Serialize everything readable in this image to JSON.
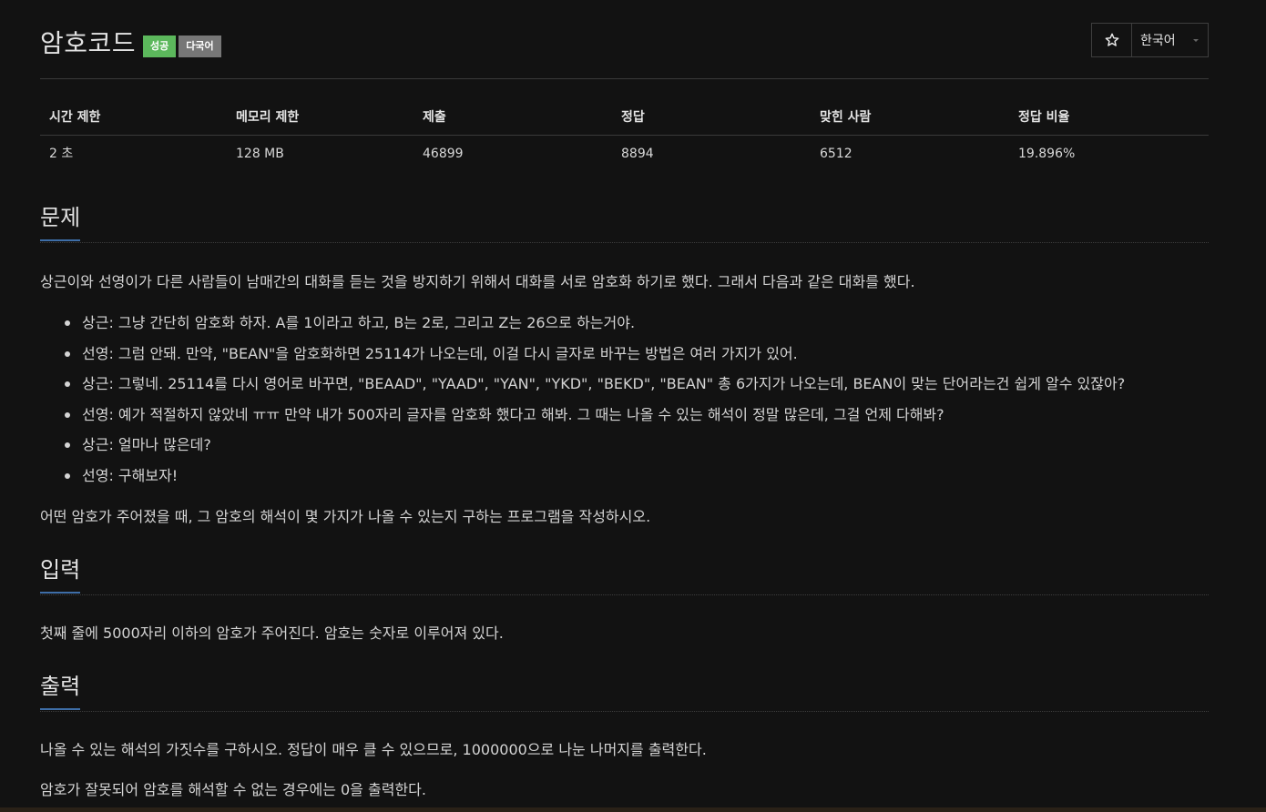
{
  "header": {
    "title": "암호코드",
    "badges": {
      "success": "성공",
      "multilang": "다국어"
    },
    "star_icon": "star-outline-icon",
    "language": "한국어"
  },
  "stats": {
    "headers": [
      "시간 제한",
      "메모리 제한",
      "제출",
      "정답",
      "맞힌 사람",
      "정답 비율"
    ],
    "values": [
      "2 초",
      "128 MB",
      "46899",
      "8894",
      "6512",
      "19.896%"
    ]
  },
  "problem": {
    "title": "문제",
    "intro": "상근이와 선영이가 다른 사람들이 남매간의 대화를 듣는 것을 방지하기 위해서 대화를 서로 암호화 하기로 했다. 그래서 다음과 같은 대화를 했다.",
    "dialog": [
      "상근: 그냥 간단히 암호화 하자. A를 1이라고 하고, B는 2로, 그리고 Z는 26으로 하는거야.",
      "선영: 그럼 안돼. 만약, \"BEAN\"을 암호화하면 25114가 나오는데, 이걸 다시 글자로 바꾸는 방법은 여러 가지가 있어.",
      "상근: 그렇네. 25114를 다시 영어로 바꾸면, \"BEAAD\", \"YAAD\", \"YAN\", \"YKD\", \"BEKD\", \"BEAN\" 총 6가지가 나오는데, BEAN이 맞는 단어라는건 쉽게 알수 있잖아?",
      "선영: 예가 적절하지 않았네 ㅠㅠ 만약 내가 500자리 글자를 암호화 했다고 해봐. 그 때는 나올 수 있는 해석이 정말 많은데, 그걸 언제 다해봐?",
      "상근: 얼마나 많은데?",
      "선영: 구해보자!"
    ],
    "outro": "어떤 암호가 주어졌을 때, 그 암호의 해석이 몇 가지가 나올 수 있는지 구하는 프로그램을 작성하시오."
  },
  "input": {
    "title": "입력",
    "text": "첫째 줄에 5000자리 이하의 암호가 주어진다. 암호는 숫자로 이루어져 있다."
  },
  "output": {
    "title": "출력",
    "text1": "나올 수 있는 해석의 가짓수를 구하시오. 정답이 매우 클 수 있으므로, 1000000으로 나눈 나머지를 출력한다.",
    "text2": "암호가 잘못되어 암호를 해석할 수 없는 경우에는 0을 출력한다."
  },
  "colors": {
    "background": "#121212",
    "success_badge": "#5cb85c",
    "multilang_badge": "#777777",
    "section_underline": "#3e6ea8"
  }
}
